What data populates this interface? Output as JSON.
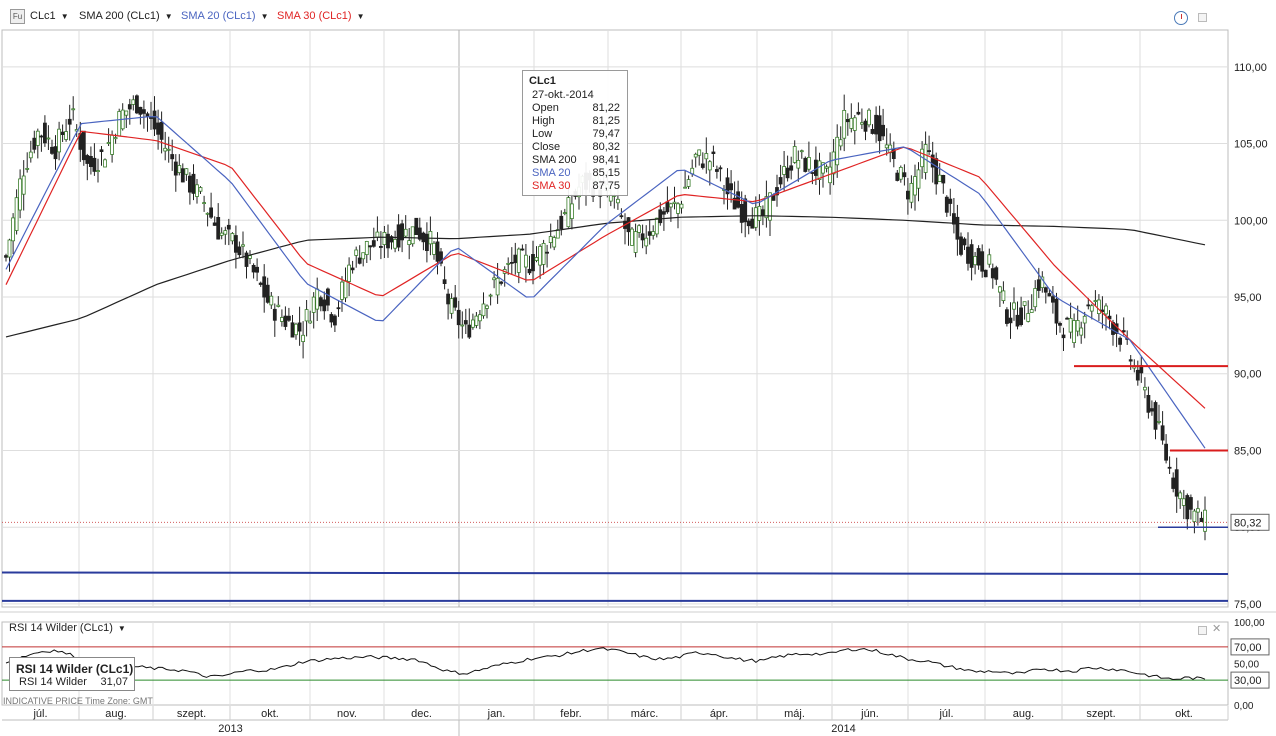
{
  "toolbar": {
    "fu_icon": "Fu",
    "symbol": "CLc1",
    "sma200": "SMA 200 (CLc1)",
    "sma20": "SMA 20 (CLc1)",
    "sma30": "SMA 30 (CLc1)",
    "dropdown_glyph": "▼"
  },
  "colors": {
    "sma200": "#222222",
    "sma20": "#4a64c0",
    "sma30": "#e02424",
    "support": "#2a3b9c",
    "resistance": "#d91c1c",
    "rsi": "#111111"
  },
  "tooltip": {
    "title": "CLc1",
    "date": "27-okt.-2014",
    "rows": [
      {
        "k": "Open",
        "v": "81,22"
      },
      {
        "k": "High",
        "v": "81,25"
      },
      {
        "k": "Low",
        "v": "79,47"
      },
      {
        "k": "Close",
        "v": "80,32"
      },
      {
        "k": "SMA 200",
        "v": "98,41"
      },
      {
        "k": "SMA 20",
        "v": "85,15"
      },
      {
        "k": "SMA 30",
        "v": "87,75"
      }
    ]
  },
  "rsi": {
    "title": "RSI 14 Wilder (CLc1)",
    "legend_title": "RSI 14 Wilder (CLc1)",
    "legend_key": "RSI 14 Wilder",
    "legend_value": "31,07",
    "footer": "INDICATIVE PRICE   Time Zone: GMT"
  },
  "chart_data": [
    {
      "type": "candlestick",
      "symbol": "CLc1",
      "x_axis": {
        "months": [
          "júl.",
          "aug.",
          "szept.",
          "okt.",
          "nov.",
          "dec.",
          "jan.",
          "febr.",
          "márc.",
          "ápr.",
          "máj.",
          "jún.",
          "júl.",
          "aug.",
          "szept.",
          "okt."
        ],
        "years": [
          "2013",
          "2014"
        ]
      },
      "y_axis": {
        "ticks": [
          "110,00",
          "105,00",
          "100,00",
          "95,00",
          "90,00",
          "85,00",
          "80,00",
          "75,00"
        ],
        "range": [
          74.8,
          112.4
        ]
      },
      "last_price_label": "80,32",
      "weekly_closes": [
        97.6,
        103.2,
        105.9,
        104.7,
        106.9,
        103.4,
        104.4,
        106.9,
        107.7,
        106.1,
        104.2,
        102.6,
        101.3,
        99.2,
        98.5,
        96.7,
        94.6,
        93.5,
        92.8,
        95.5,
        93.7,
        97.3,
        98.3,
        98.6,
        99.1,
        99.4,
        98.4,
        94.4,
        92.7,
        94.7,
        96.1,
        97.4,
        97.2,
        98.6,
        100.2,
        102.4,
        102.3,
        101.4,
        98.6,
        99.2,
        100.4,
        101.1,
        104.1,
        103.9,
        101.6,
        100.4,
        100.1,
        102.3,
        104.2,
        103.5,
        102.8,
        106.5,
        106.8,
        106.1,
        103.8,
        101.8,
        104.5,
        102.2,
        98.4,
        97.5,
        96.9,
        93.8,
        93.9,
        96.2,
        93.4,
        92.7,
        94.8,
        93.9,
        92.2,
        89.6,
        86.9,
        83.2,
        81.1,
        80.32
      ],
      "sma200": {
        "name": "SMA 200",
        "values": [
          92.4,
          93.6,
          95.8,
          97.4,
          98.7,
          98.9,
          98.8,
          99.1,
          99.8,
          100.2,
          100.3,
          100.2,
          100.0,
          99.7,
          99.6,
          99.4,
          98.4
        ]
      },
      "sma20": {
        "name": "SMA 20",
        "values": [
          96.8,
          106.3,
          106.8,
          102.5,
          95.9,
          93.3,
          98.3,
          94.8,
          99.7,
          103.4,
          101.0,
          103.9,
          104.8,
          101.7,
          95.0,
          92.2,
          85.15
        ]
      },
      "sma30": {
        "name": "SMA 30",
        "values": [
          95.8,
          105.8,
          105.2,
          103.5,
          97.2,
          95.0,
          97.9,
          96.0,
          99.0,
          101.7,
          101.2,
          103.0,
          104.8,
          102.8,
          97.0,
          92.2,
          87.75
        ]
      },
      "horizontal_lines": [
        {
          "label": "resistance",
          "value": 90.5
        },
        {
          "label": "resistance",
          "value": 85.0
        },
        {
          "label": "support",
          "value": 80.0
        },
        {
          "label": "support",
          "value": 77.0
        },
        {
          "label": "support",
          "value": 75.2
        },
        {
          "label": "last price",
          "value": 80.32
        }
      ]
    },
    {
      "type": "line",
      "title": "RSI 14 Wilder (CLc1)",
      "y_axis": {
        "ticks": [
          "100,00",
          "70,00",
          "50,00",
          "30,00",
          "0,00"
        ],
        "range": [
          0,
          100
        ]
      },
      "levels": [
        70,
        30
      ],
      "last_value": 31.07,
      "series": [
        {
          "name": "RSI 14 Wilder",
          "values": [
            52,
            58,
            64,
            66,
            60,
            54,
            51,
            47,
            46,
            44,
            43,
            41,
            35,
            34,
            39,
            42,
            42,
            46,
            52,
            54,
            56,
            57,
            58,
            57,
            56,
            55,
            47,
            40,
            38,
            43,
            48,
            52,
            56,
            58,
            61,
            65,
            68,
            66,
            62,
            57,
            55,
            58,
            63,
            62,
            57,
            54,
            53,
            58,
            61,
            62,
            61,
            66,
            68,
            65,
            60,
            55,
            53,
            48,
            44,
            40,
            41,
            38,
            38,
            44,
            42,
            41,
            45,
            44,
            42,
            38,
            34,
            31,
            33,
            31.07
          ]
        }
      ]
    }
  ]
}
